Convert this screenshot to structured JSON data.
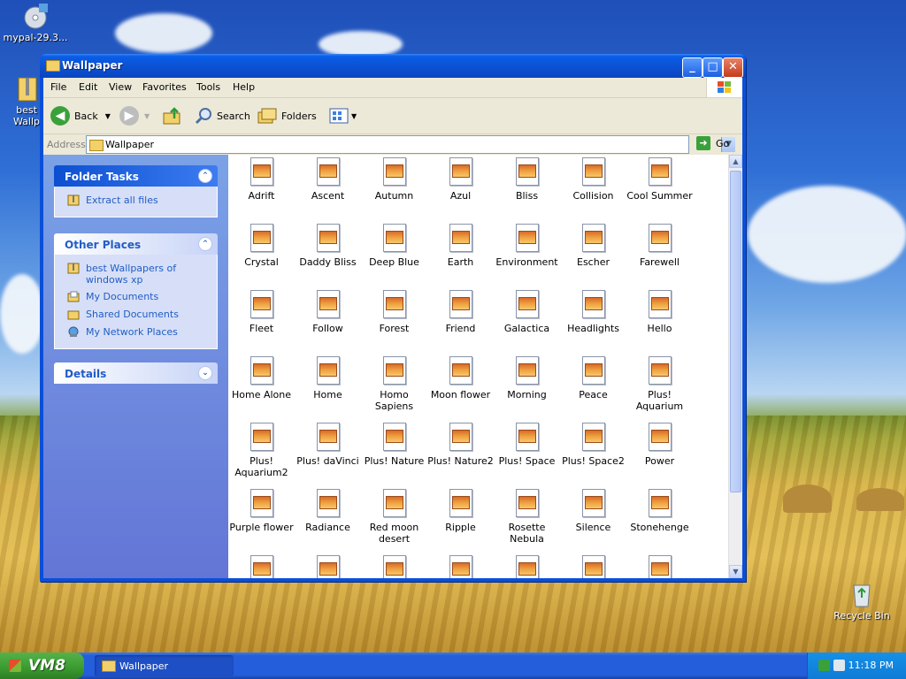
{
  "desktop": {
    "icons": [
      {
        "label": "mypal-29.3...",
        "icon": "installer-disc-icon"
      },
      {
        "label": "best Wallpap",
        "icon": "zip-folder-icon"
      },
      {
        "label": "Recycle Bin",
        "icon": "recycle-bin-icon"
      }
    ]
  },
  "window": {
    "title": "Wallpaper",
    "buttons": {
      "minimize": "_",
      "maximize": "□",
      "close": "✕"
    },
    "menu": [
      "File",
      "Edit",
      "View",
      "Favorites",
      "Tools",
      "Help"
    ],
    "toolbar": {
      "back": "Back",
      "search": "Search",
      "folders": "Folders"
    },
    "address": {
      "label": "Address",
      "value": "Wallpaper",
      "go": "Go"
    },
    "tasks": {
      "folder_tasks": {
        "title": "Folder Tasks",
        "items": [
          "Extract all files"
        ]
      },
      "other_places": {
        "title": "Other Places",
        "items": [
          "best Wallpapers of windows xp",
          "My Documents",
          "Shared Documents",
          "My Network Places"
        ]
      },
      "details": {
        "title": "Details"
      }
    },
    "files": [
      "Adrift",
      "Ascent",
      "Autumn",
      "Azul",
      "Bliss",
      "Collision",
      "Cool Summer",
      "Crystal",
      "Daddy Bliss",
      "Deep Blue",
      "Earth",
      "Environment",
      "Escher",
      "Farewell",
      "Fleet",
      "Follow",
      "Forest",
      "Friend",
      "Galactica",
      "Headlights",
      "Hello",
      "Home Alone",
      "Home",
      "Homo Sapiens",
      "Moon flower",
      "Morning",
      "Peace",
      "Plus! Aquarium",
      "Plus! Aquarium2",
      "Plus! daVinci",
      "Plus! Nature",
      "Plus! Nature2",
      "Plus! Space",
      "Plus! Space2",
      "Power",
      "Purple flower",
      "Radiance",
      "Red moon desert",
      "Ripple",
      "Rosette Nebula",
      "Silence",
      "Stonehenge",
      "",
      "",
      "",
      "",
      "",
      "",
      ""
    ]
  },
  "taskbar": {
    "start_label": "VM8",
    "task": "Wallpaper",
    "clock": "11:18 PM"
  }
}
